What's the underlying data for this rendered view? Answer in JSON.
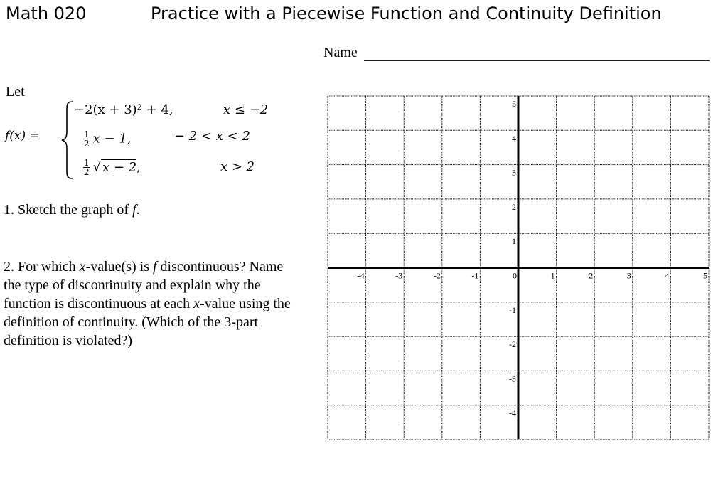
{
  "header": {
    "course": "Math 020",
    "title": "Practice with a Piecewise Function and Continuity Definition",
    "name_label": "Name"
  },
  "problem": {
    "intro": "Let",
    "function_name": "f(x) =",
    "pieces": [
      {
        "expression": "−2(x + 3)² + 4,",
        "condition": "x ≤ −2"
      },
      {
        "expression": "½x − 1,",
        "coefficient_num": "1",
        "coefficient_den": "2",
        "body": "x − 1,",
        "condition": "− 2 < x < 2"
      },
      {
        "expression": "½√(x − 2),",
        "coefficient_num": "1",
        "coefficient_den": "2",
        "radicand": "x − 2",
        "trailing": ",",
        "condition": "x > 2"
      }
    ],
    "questions": [
      {
        "number": "1.",
        "text_before": "Sketch the graph of",
        "var": "f",
        "text_after": "."
      },
      {
        "number": "2.",
        "text": "For which x-value(s) is f discontinuous? Name the type of discontinuity and explain why the function is discontinuous at each x-value using the definition of continuity. (Which of the 3-part definition is violated?)",
        "parts": [
          "For which ",
          "x",
          "-value(s) is ",
          "f",
          " discontinuous? Name the type of discontinuity and explain why the function is discontinuous at each ",
          "x",
          "-value using the definition of continuity. (Which of the 3-part definition is violated?)"
        ]
      }
    ]
  },
  "graph": {
    "x_range": [
      -5,
      5
    ],
    "y_range": [
      -5,
      5
    ],
    "grid_step": 1,
    "grid_style": "dotted",
    "x_tick_labels": [
      "-4",
      "-3",
      "-2",
      "-1",
      "0",
      "1",
      "2",
      "3",
      "4",
      "5"
    ],
    "y_tick_labels": [
      "5",
      "4",
      "3",
      "2",
      "1",
      "-1",
      "-2",
      "-3",
      "-4"
    ],
    "x_tick_values": [
      -4,
      -3,
      -2,
      -1,
      0,
      1,
      2,
      3,
      4,
      5
    ],
    "y_tick_values": [
      5,
      4,
      3,
      2,
      1,
      -1,
      -2,
      -3,
      -4
    ]
  }
}
